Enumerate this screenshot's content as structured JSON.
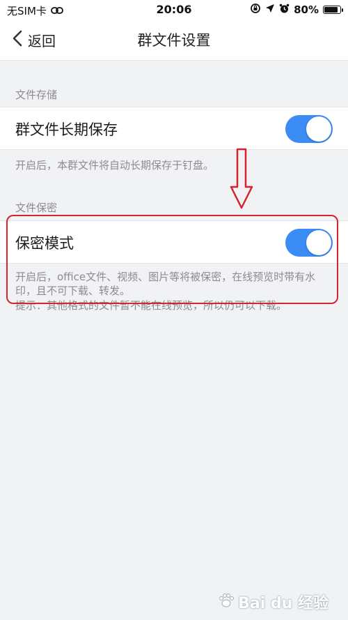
{
  "status_bar": {
    "carrier": "无SIM卡",
    "time": "20:06",
    "battery": "80%"
  },
  "nav": {
    "back_label": "返回",
    "title": "群文件设置"
  },
  "sections": [
    {
      "header": "文件存储",
      "row_label": "群文件长期保存",
      "toggle_on": true,
      "description": "开启后，本群文件将自动长期保存于钉盘。"
    },
    {
      "header": "文件保密",
      "row_label": "保密模式",
      "toggle_on": true,
      "description": "开启后，office文件、视频、图片等将被保密，在线预览时带有水印，且不可下载、转发。",
      "hint": "提示：其他格式的文件暂不能在线预览，所以仍可以下载。"
    }
  ],
  "colors": {
    "toggle_on": "#3b8cf5",
    "annotation": "#d5232f",
    "background": "#f1f2f4"
  },
  "watermark": {
    "text": "Bai du 经验"
  }
}
